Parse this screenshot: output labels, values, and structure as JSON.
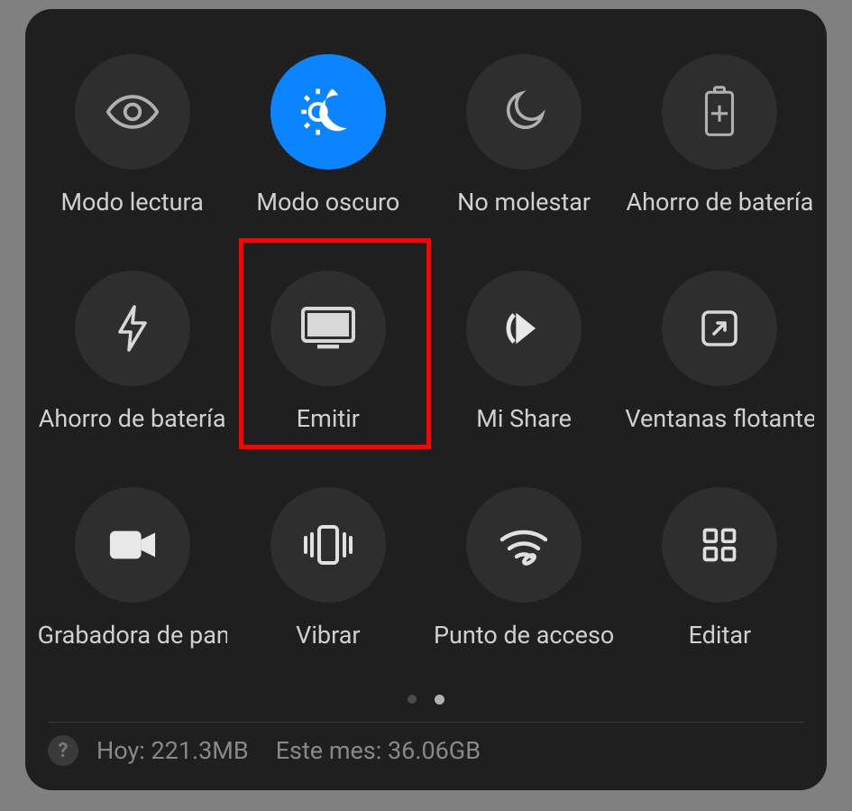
{
  "tiles": [
    {
      "label": "Modo lectura",
      "icon": "eye",
      "active": false
    },
    {
      "label": "Modo oscuro",
      "icon": "dark-mode",
      "active": true
    },
    {
      "label": "No molestar",
      "icon": "moon",
      "active": false
    },
    {
      "label": "Ahorro de batería",
      "icon": "battery-plus",
      "active": false
    },
    {
      "label": "Ahorro de batería",
      "icon": "bolt",
      "active": false
    },
    {
      "label": "Emitir",
      "icon": "cast",
      "active": false
    },
    {
      "label": "Mi Share",
      "icon": "mishare",
      "active": false
    },
    {
      "label": "Ventanas flotantes",
      "icon": "float-window",
      "active": false
    },
    {
      "label": "Grabadora de pantalla",
      "icon": "video",
      "active": false
    },
    {
      "label": "Vibrar",
      "icon": "vibrate",
      "active": false
    },
    {
      "label": "Punto de acceso",
      "icon": "hotspot",
      "active": false
    },
    {
      "label": "Editar",
      "icon": "grid",
      "active": false
    }
  ],
  "highlight_index": 5,
  "pagination": {
    "count": 2,
    "active": 1
  },
  "footer": {
    "today": "Hoy: 221.3MB",
    "month": "Este mes: 36.06GB",
    "help": "?"
  },
  "colors": {
    "accent": "#0a84ff"
  }
}
